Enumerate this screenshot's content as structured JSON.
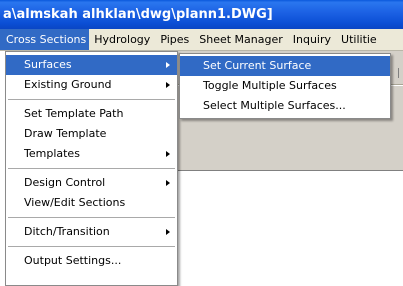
{
  "title": "a\\almskah alhklan\\dwg\\plann1.DWG]",
  "menubar": [
    "Cross Sections",
    "Hydrology",
    "Pipes",
    "Sheet Manager",
    "Inquiry",
    "Utilitie"
  ],
  "main_menu": {
    "groups": [
      [
        "Surfaces",
        "Existing Ground"
      ],
      [
        "Set Template Path",
        "Draw Template",
        "Templates"
      ],
      [
        "Design Control",
        "View/Edit Sections"
      ],
      [
        "Ditch/Transition"
      ],
      [
        "Output Settings..."
      ]
    ]
  },
  "submenu": [
    "Set Current Surface",
    "Toggle Multiple Surfaces",
    "Select Multiple Surfaces..."
  ],
  "colors": {
    "title": "#0b4fd5",
    "highlight": "#316ac5"
  }
}
